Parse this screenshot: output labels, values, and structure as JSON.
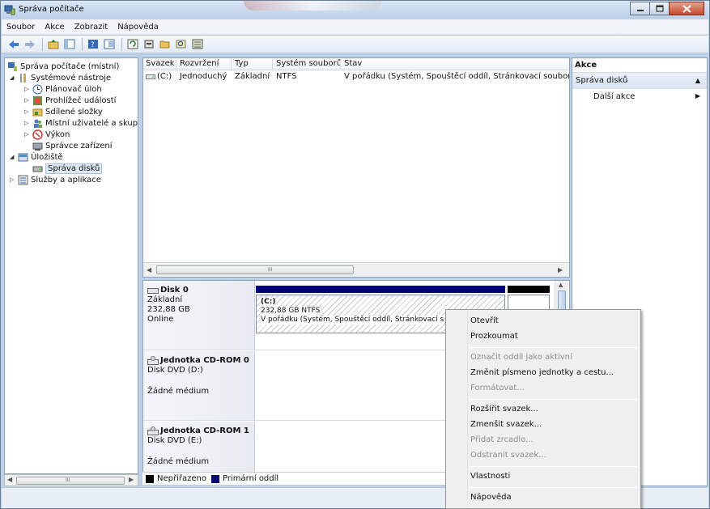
{
  "window": {
    "title": "Správa počítače",
    "accent": "#bcd1e8"
  },
  "menubar": {
    "items": [
      "Soubor",
      "Akce",
      "Zobrazit",
      "Nápověda"
    ]
  },
  "toolbar": {
    "icons": [
      "back-icon",
      "forward-icon",
      "up-folder-icon",
      "show-tree-icon",
      "help-icon",
      "properties-icon",
      "refresh-icon",
      "disk-settings-icon",
      "open-icon",
      "search-icon",
      "export-icon"
    ]
  },
  "tree": {
    "items": [
      {
        "label": "Správa počítače (místní)",
        "arrow": "",
        "icon": "computer-management-icon"
      },
      {
        "label": "Systémové nástroje",
        "arrow": "◢",
        "icon": "tools-icon"
      },
      {
        "label": "Plánovač úloh",
        "arrow": "▷",
        "icon": "clock-icon"
      },
      {
        "label": "Prohlížeč událostí",
        "arrow": "▷",
        "icon": "event-viewer-icon"
      },
      {
        "label": "Sdílené složky",
        "arrow": "▷",
        "icon": "shared-folder-icon"
      },
      {
        "label": "Místní uživatelé a skupiny",
        "arrow": "▷",
        "icon": "users-icon"
      },
      {
        "label": "Výkon",
        "arrow": "▷",
        "icon": "performance-icon"
      },
      {
        "label": "Správce zařízení",
        "arrow": "",
        "icon": "device-manager-icon"
      },
      {
        "label": "Úložiště",
        "arrow": "◢",
        "icon": "storage-icon"
      },
      {
        "label": "Správa disků",
        "arrow": "",
        "icon": "disk-management-icon"
      },
      {
        "label": "Služby a aplikace",
        "arrow": "▷",
        "icon": "services-icon"
      }
    ],
    "scroll_grip": "III"
  },
  "volumes": {
    "columns": [
      "Svazek",
      "Rozvržení",
      "Typ",
      "Systém souborů",
      "Stav"
    ],
    "rows": [
      {
        "volume": "(C:)",
        "layout": "Jednoduchý",
        "type": "Základní",
        "fs": "NTFS",
        "status": "V pořádku (Systém, Spouštěcí oddíl, Stránkovací soubor, Ak"
      }
    ],
    "scroll_grip": "III"
  },
  "disks": [
    {
      "name": "Disk 0",
      "type": "Základní",
      "size": "232,88 GB",
      "state": "Online",
      "partition": {
        "label": "(C:)",
        "size_fs": "232,88 GB NTFS",
        "status": "V pořádku (Systém, Spouštěcí oddíl, Stránkovací s"
      }
    },
    {
      "name": "Jednotka CD-ROM 0",
      "type": "Disk DVD (D:)",
      "state": "Žádné médium"
    },
    {
      "name": "Jednotka CD-ROM 1",
      "type": "Disk DVD (E:)",
      "state": "Žádné médium"
    }
  ],
  "legend": [
    {
      "label": "Nepřiřazeno",
      "color": "#000000"
    },
    {
      "label": "Primární oddíl",
      "color": "#00007a"
    }
  ],
  "actions": {
    "heading": "Akce",
    "section": "Správa disků",
    "more": "Další akce"
  },
  "context_menu": {
    "items": [
      {
        "label": "Otevřít",
        "enabled": true
      },
      {
        "label": "Prozkoumat",
        "enabled": true
      },
      {
        "label": "Označit oddíl jako aktivní",
        "enabled": false
      },
      {
        "label": "Změnit písmeno jednotky a cestu...",
        "enabled": true
      },
      {
        "label": "Formátovat...",
        "enabled": false
      },
      {
        "label": "Rozšířit svazek...",
        "enabled": true
      },
      {
        "label": "Zmenšit svazek...",
        "enabled": true
      },
      {
        "label": "Přidat zrcadlo...",
        "enabled": false
      },
      {
        "label": "Odstranit svazek...",
        "enabled": false
      },
      {
        "label": "Vlastnosti",
        "enabled": true
      },
      {
        "label": "Nápověda",
        "enabled": true
      }
    ]
  }
}
